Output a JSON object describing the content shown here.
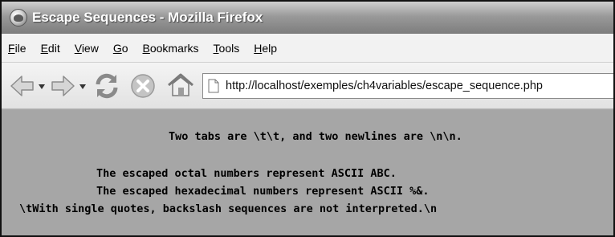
{
  "window": {
    "title": "Escape Sequences - Mozilla Firefox"
  },
  "menubar": {
    "items": [
      {
        "underline": "F",
        "rest": "ile"
      },
      {
        "underline": "E",
        "rest": "dit"
      },
      {
        "underline": "V",
        "rest": "iew"
      },
      {
        "underline": "G",
        "rest": "o"
      },
      {
        "underline": "B",
        "rest": "ookmarks"
      },
      {
        "underline": "T",
        "rest": "ools"
      },
      {
        "underline": "H",
        "rest": "elp"
      }
    ]
  },
  "navbar": {
    "url": "http://localhost/exemples/ch4variables/escape_sequence.php",
    "icons": [
      "back-arrow-icon",
      "dropdown-arrow-icon",
      "forward-arrow-icon",
      "reload-icon",
      "stop-icon",
      "home-icon",
      "page-icon"
    ]
  },
  "content": {
    "lines": [
      "Two tabs are \\t\\t, and two newlines are \\n\\n.",
      "The escaped octal numbers represent ASCII ABC.",
      "The escaped hexadecimal numbers represent ASCII %&.",
      "\\tWith single quotes, backslash sequences are not interpreted.\\n"
    ]
  },
  "colors": {
    "content_background": "#a6a6a6",
    "title_text": "#ffffff"
  }
}
